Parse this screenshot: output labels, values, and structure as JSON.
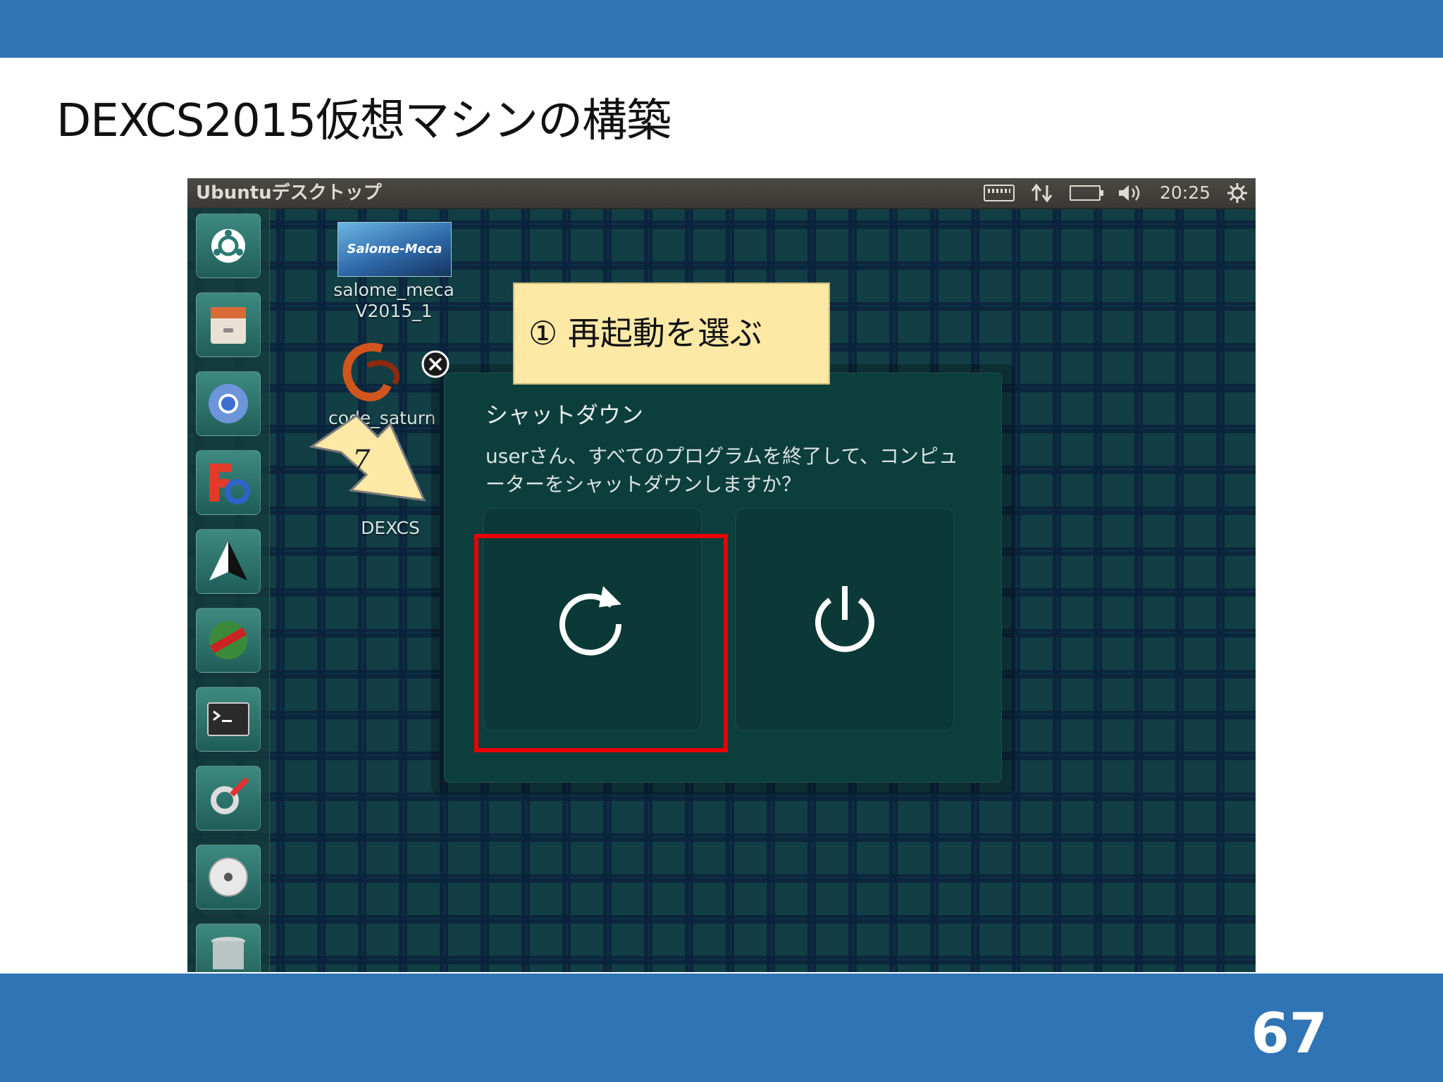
{
  "slide": {
    "title": "DEXCS2015仮想マシンの構築",
    "page_number": "67"
  },
  "panel": {
    "title": "Ubuntuデスクトップ",
    "clock": "20:25",
    "indicator_icons": [
      "keyboard-icon",
      "network-icon",
      "battery-icon",
      "volume-icon",
      "gear-icon"
    ]
  },
  "launcher": {
    "items": [
      "ubuntu-dash-icon",
      "files-icon",
      "chromium-icon",
      "freecad-icon",
      "paraview-icon",
      "ruby-icon",
      "terminal-icon",
      "settings-icon",
      "dvd-icon",
      "trash-icon"
    ]
  },
  "desktop": {
    "salome_thumb_text": "Salome-Meca",
    "salome_label_line1": "salome_meca",
    "salome_label_line2": "V2015_1",
    "code_saturne_label": "code_saturn",
    "dexcs_label": "DEXCS"
  },
  "dialog": {
    "title": "シャットダウン",
    "message": "userさん、すべてのプログラムを終了して、コンピューターをシャットダウンしますか？",
    "buttons": [
      "restart-icon",
      "power-icon"
    ]
  },
  "annotation": {
    "callout_text": "① 再起動を選ぶ",
    "arrow_label": "7"
  },
  "colors": {
    "slide_bar": "#2f74b5",
    "callout_bg": "#fde9a6",
    "highlight": "#e80000",
    "dialog_bg": "#0c3e3c"
  }
}
